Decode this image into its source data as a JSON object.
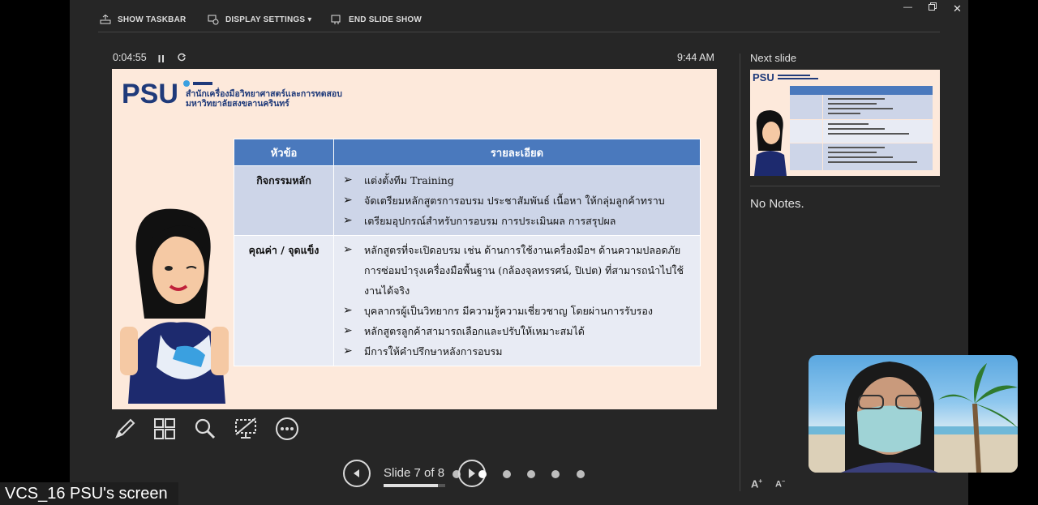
{
  "toolbar": {
    "show_taskbar": "SHOW TASKBAR",
    "display_settings": "DISPLAY SETTINGS ▾",
    "end_slide_show": "END SLIDE SHOW"
  },
  "timer": {
    "elapsed": "0:04:55",
    "clock": "9:44 AM"
  },
  "slide": {
    "logo": "PSU",
    "org_line1": "สำนักเครื่องมือวิทยาศาสตร์และการทดสอบ",
    "org_line2": "มหาวิทยาลัยสงขลานครินทร์",
    "table": {
      "headers": [
        "หัวข้อ",
        "รายละเอียด"
      ],
      "rows": [
        {
          "topic": "กิจกรรมหลัก",
          "items": [
            "แต่งตั้งทีม Training",
            "จัดเตรียมหลักสูตรการอบรม ประชาสัมพันธ์ เนื้อหา ให้กลุ่มลูกค้าทราบ",
            "เตรียมอุปกรณ์สำหรับการอบรม การประเมินผล การสรุปผล"
          ]
        },
        {
          "topic": "คุณค่า / จุดแข็ง",
          "items": [
            "หลักสูตรที่จะเปิดอบรม เช่น ด้านการใช้งานเครื่องมือฯ ด้านความปลอดภัย การซ่อมบำรุงเครื่องมือพื้นฐาน (กล้องจุลทรรศน์, ปิเปต) ที่สามารถนำไปใช้งานได้จริง",
            "บุคลากรผู้เป็นวิทยากร มีความรู้ความเชี่ยวชาญ โดยผ่านการรับรอง",
            "หลักสูตรลูกค้าสามารถเลือกและปรับให้เหมาะสมได้",
            "มีการให้คำปรึกษาหลังการอบรม"
          ]
        }
      ]
    }
  },
  "navigation": {
    "slide_label": "Slide 7 of 8",
    "progress": 0.875
  },
  "next_slide": {
    "title": "Next slide"
  },
  "notes": {
    "text": "No Notes."
  },
  "caption": {
    "text": "VCS_16 PSU's screen"
  },
  "colors": {
    "table_header": "#4a79bd",
    "slide_bg": "#fde9db",
    "panel_bg": "#262626"
  }
}
